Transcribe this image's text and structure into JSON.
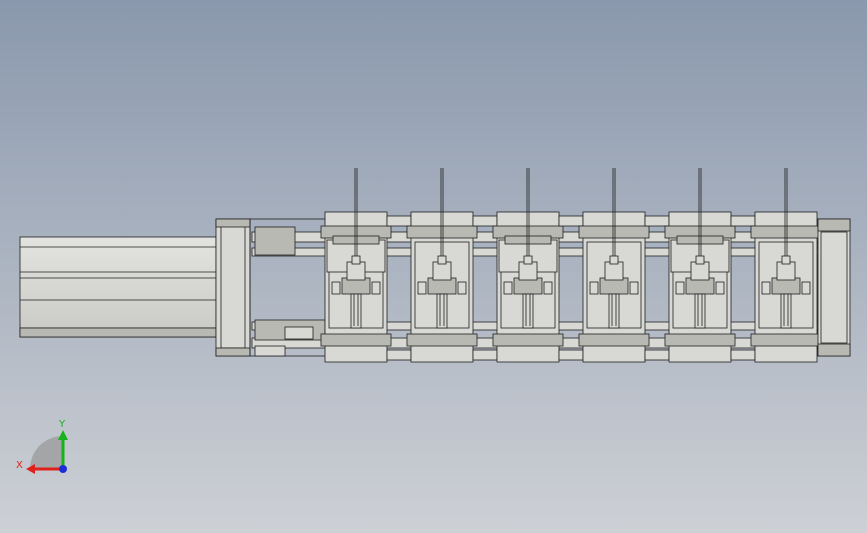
{
  "viewport": {
    "background_top": "#8a98ad",
    "background_bottom": "#cdd0d5"
  },
  "model": {
    "part_fill": "#d8d8d4",
    "part_fill_dark": "#b9b9b4",
    "edge_color": "#1e1e1e",
    "module_count": 6
  },
  "triad": {
    "x_label": "X",
    "y_label": "Y",
    "x_color": "#e0201a",
    "y_color": "#18b21a",
    "z_color": "#1a2fd6"
  }
}
